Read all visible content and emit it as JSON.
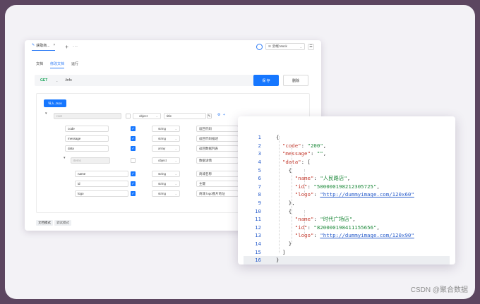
{
  "tab": {
    "title": "获取商...",
    "close": "×"
  },
  "toolbar": {
    "plus": "+",
    "more": "···"
  },
  "env": {
    "label": "云端 Mock",
    "grid": "⊞",
    "chev": "⌄",
    "menu": "☰"
  },
  "subtabs": [
    "文档",
    "修改文档",
    "运行"
  ],
  "request": {
    "method": "GET",
    "path": "/info",
    "save": "保 存",
    "delete": "删除"
  },
  "schema": {
    "import_label": "导入 Json",
    "root": {
      "name": "root",
      "type": "object",
      "desc": "title"
    },
    "rows": [
      {
        "name": "code",
        "type": "string",
        "desc": "返回代码",
        "checked": true
      },
      {
        "name": "message",
        "type": "string",
        "desc": "返回代码描述",
        "checked": true
      },
      {
        "name": "data",
        "type": "array",
        "desc": "返回数据列表",
        "checked": true
      },
      {
        "name": "items",
        "type": "object",
        "desc": "数据详情",
        "checked": false
      },
      {
        "name": "name",
        "type": "string",
        "desc": "商城名称",
        "checked": true
      },
      {
        "name": "id",
        "type": "string",
        "desc": "主键",
        "checked": true
      },
      {
        "name": "logo",
        "type": "string",
        "desc": "商城 logo图片地址",
        "checked": true
      }
    ]
  },
  "modes": [
    "文档模式",
    "调试模式"
  ],
  "json": {
    "line_numbers": [
      "1",
      "2",
      "3",
      "4",
      "5",
      "6",
      "7",
      "8",
      "9",
      "10",
      "11",
      "12",
      "13",
      "14",
      "15",
      "16"
    ],
    "keys": {
      "code": "\"code\"",
      "message": "\"message\"",
      "data": "\"data\"",
      "name": "\"name\"",
      "id": "\"id\"",
      "logo": "\"logo\""
    },
    "values": {
      "code": "\"200\"",
      "message": "\"\"",
      "name1": "\"人民路店\"",
      "id1": "\"500000198212305725\"",
      "logo1": "\"http://dummyimage.com/120x60\"",
      "name2": "\"时代广场店\"",
      "id2": "\"820000198411155656\"",
      "logo2": "\"http://dummyimage.com/120x90\""
    }
  },
  "watermark": "CSDN @聚合数据"
}
